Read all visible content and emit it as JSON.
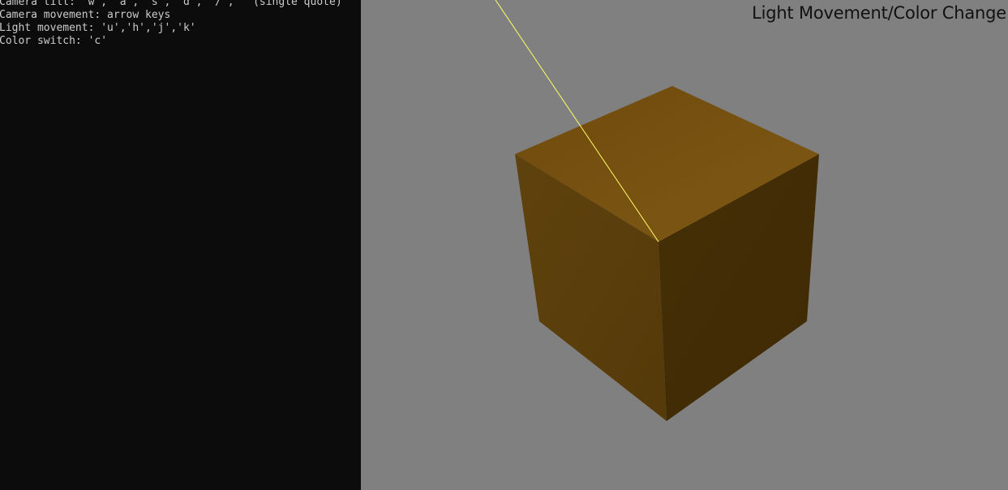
{
  "console": {
    "lines": [
      "Camera tilt: 'w', 'a', 's', 'd', '/', ' (single quote)'",
      "Camera movement: arrow keys",
      "Light movement: 'u','h','j','k'",
      "Color switch: 'c'"
    ],
    "background_color": "#0c0c0c",
    "text_color": "#cccccc"
  },
  "viewport": {
    "title": "Light Movement/Color Change",
    "background_color": "#808080",
    "cube": {
      "top_face_color": "#7a5412",
      "left_face_color": "#5a3f0c",
      "right_face_color": "#432e06"
    },
    "light_ray_color": "#ffff66"
  }
}
